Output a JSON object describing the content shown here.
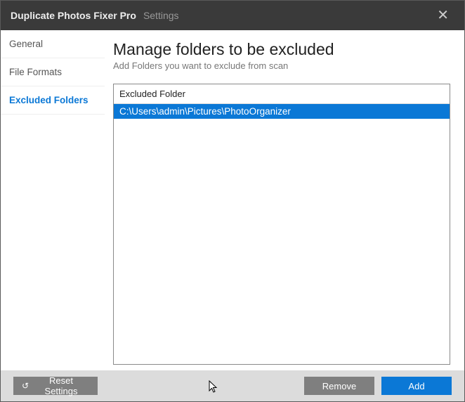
{
  "titlebar": {
    "app_name": "Duplicate Photos Fixer Pro",
    "crumb": "Settings",
    "close_glyph": "✕"
  },
  "sidebar": {
    "items": [
      {
        "label": "General",
        "active": false
      },
      {
        "label": "File Formats",
        "active": false
      },
      {
        "label": "Excluded Folders",
        "active": true
      }
    ]
  },
  "main": {
    "heading": "Manage folders to be excluded",
    "subheading": "Add Folders you want to exclude from scan",
    "list_header": "Excluded Folder",
    "rows": [
      "C:\\Users\\admin\\Pictures\\PhotoOrganizer"
    ]
  },
  "footer": {
    "reset_label": "Reset Settings",
    "reset_glyph": "↺",
    "remove_label": "Remove",
    "add_label": "Add"
  },
  "colors": {
    "accent": "#0b78d6"
  },
  "cursor_glyph": "⇖"
}
